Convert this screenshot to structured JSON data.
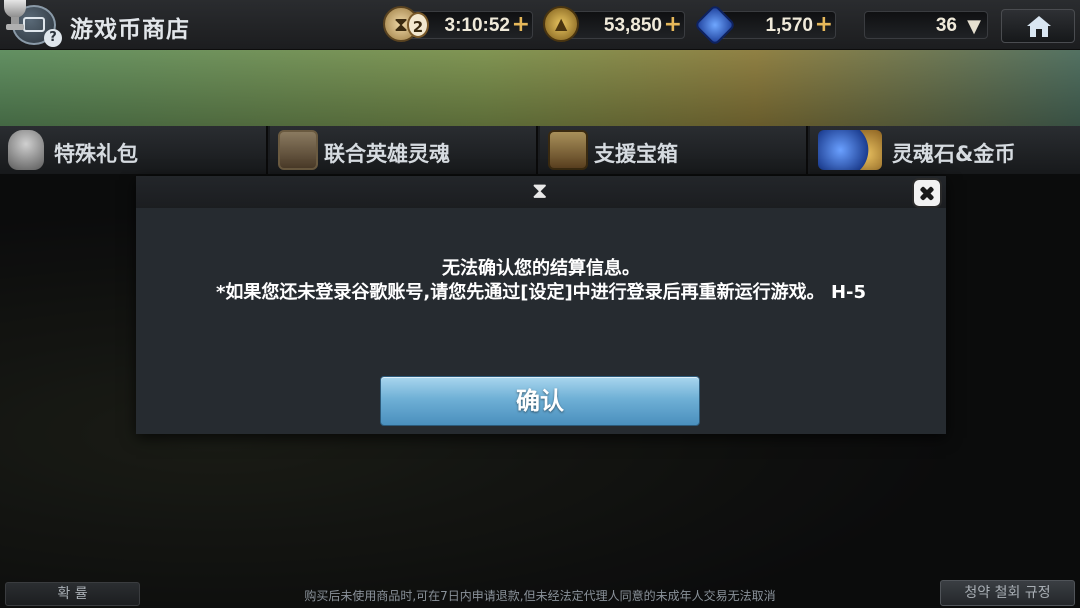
{
  "header": {
    "title": "游戏币商店",
    "stamina_count": "2",
    "timer": "3:10:52",
    "gold": "53,850",
    "gems": "1,570",
    "trophy": "36",
    "plus_symbol": "+",
    "dropdown_symbol": "▼"
  },
  "tabs": [
    {
      "label": "特殊礼包"
    },
    {
      "label": "联合英雄灵魂"
    },
    {
      "label": "支援宝箱"
    },
    {
      "label": "灵魂石&金币"
    }
  ],
  "dialog": {
    "icon": "hourglass-icon",
    "message_line1": "无法确认您的结算信息。",
    "message_line2": "*如果您还未登录谷歌账号,请您先通过[设定]中进行登录后再重新运行游戏。 H-5",
    "confirm_label": "确认"
  },
  "footer": {
    "left_label": "확 률",
    "notice": "购买后未使用商品时,可在7日内申请退款,但未经法定代理人同意的未成年人交易无法取消",
    "right_label": "청약 철회 규정"
  },
  "colors": {
    "accent_plus": "#e6b85a",
    "confirm_button": "#6fb0d6",
    "dialog_bg": "#262b30"
  }
}
